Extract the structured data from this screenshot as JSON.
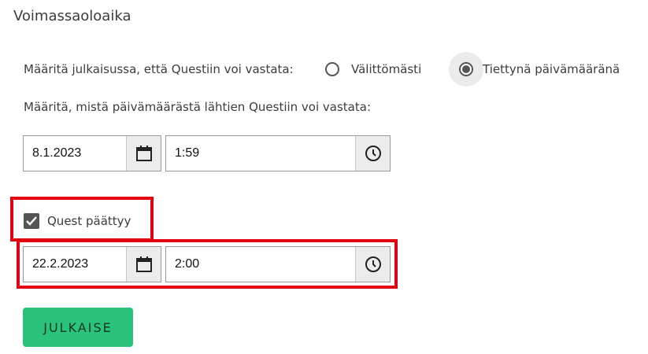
{
  "section": {
    "title": "Voimassaoloaika"
  },
  "answer_mode": {
    "prompt": "Määritä julkaisussa, että Questiin voi vastata:",
    "options": [
      {
        "label": "Välittömästi",
        "selected": false
      },
      {
        "label": "Tiettynä päivämääränä",
        "selected": true
      }
    ]
  },
  "start": {
    "prompt": "Määritä, mistä päivämäärästä lähtien Questiin voi vastata:",
    "date": "8.1.2023",
    "time": "1:59"
  },
  "end": {
    "checkbox_label": "Quest päättyy",
    "checked": true,
    "date": "22.2.2023",
    "time": "2:00"
  },
  "actions": {
    "publish_label": "JULKAISE"
  },
  "colors": {
    "highlight": "#e3000f",
    "publish_bg": "#2bc27a"
  }
}
